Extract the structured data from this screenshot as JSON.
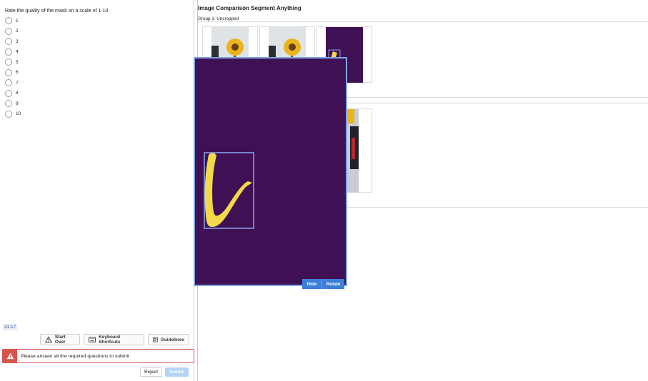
{
  "question": {
    "prompt": "Rate the quality of the mask on a scale of 1-10",
    "options": [
      "1",
      "2",
      "3",
      "4",
      "5",
      "6",
      "7",
      "8",
      "9",
      "10"
    ]
  },
  "timer": "41:17",
  "toolbar": {
    "start_over": "Start Over",
    "keyboard_shortcuts": "Keyboard Shortcuts",
    "guidelines": "Guidelines"
  },
  "error": {
    "message": "Please answer all the required questions to submit"
  },
  "actions": {
    "reject": "Reject",
    "submit": "Submit"
  },
  "viewer": {
    "title": "Image Comparison Segment Anything",
    "group_label": "Group 1: Uncropped",
    "hide_label": "Hide",
    "rotate_label": "Rotate"
  },
  "colors": {
    "mask_background": "#3f1054",
    "mask_foreground": "#f3d94a",
    "accent_blue": "#3c7fd6",
    "error_red": "#d9534f"
  },
  "icons": {
    "start_over": "warning-triangle-icon",
    "keyboard_shortcuts": "keyboard-icon",
    "guidelines": "document-icon",
    "error": "warning-triangle-icon"
  }
}
